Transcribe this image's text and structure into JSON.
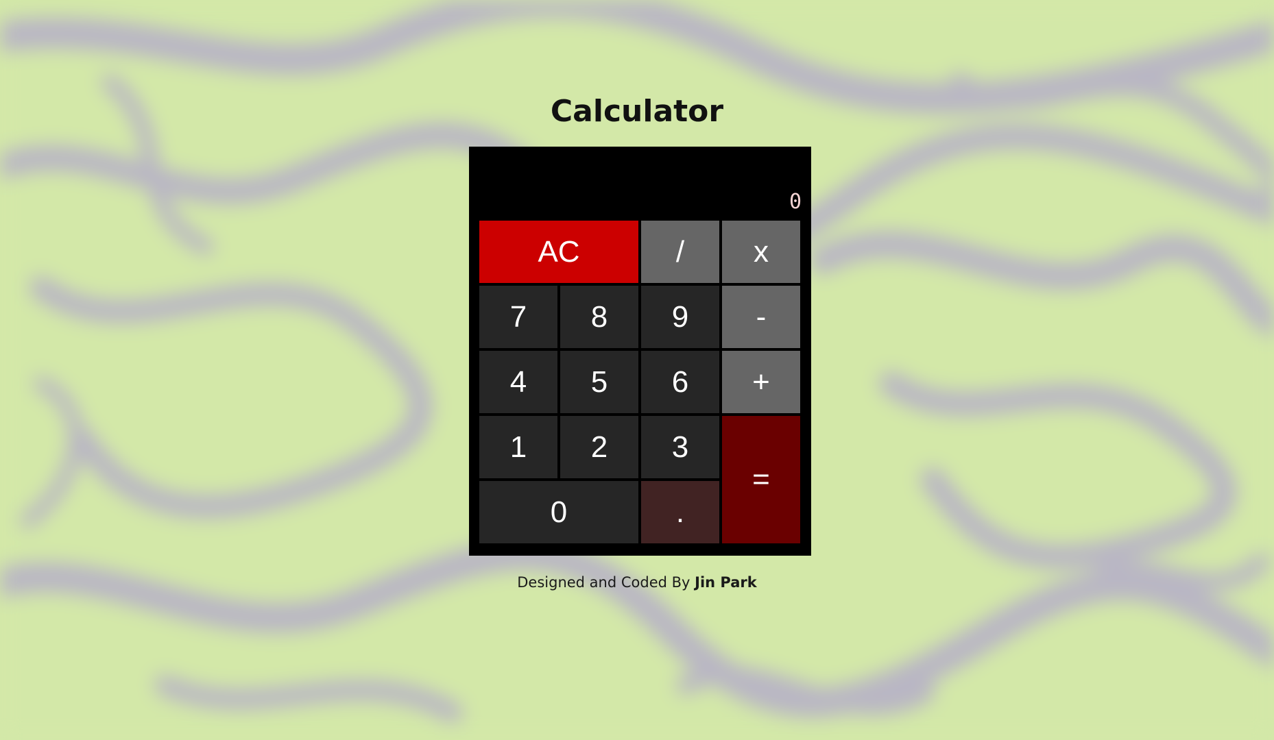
{
  "page": {
    "title": "Calculator",
    "background_colors": [
      "#d3e8a8",
      "#b9b6c4"
    ]
  },
  "calculator": {
    "display_value": "0",
    "keys": {
      "clear": "AC",
      "divide": "/",
      "multiply": "x",
      "seven": "7",
      "eight": "8",
      "nine": "9",
      "subtract": "-",
      "four": "4",
      "five": "5",
      "six": "6",
      "add": "+",
      "one": "1",
      "two": "2",
      "three": "3",
      "equals": "=",
      "zero": "0",
      "decimal": "."
    },
    "colors": {
      "body": "#000000",
      "clear": "#cc0000",
      "operator": "#666666",
      "digit": "#262626",
      "equals": "#6a0000",
      "decimal": "#412323"
    }
  },
  "footer": {
    "prefix": "Designed and Coded By",
    "author": "Jin Park"
  }
}
